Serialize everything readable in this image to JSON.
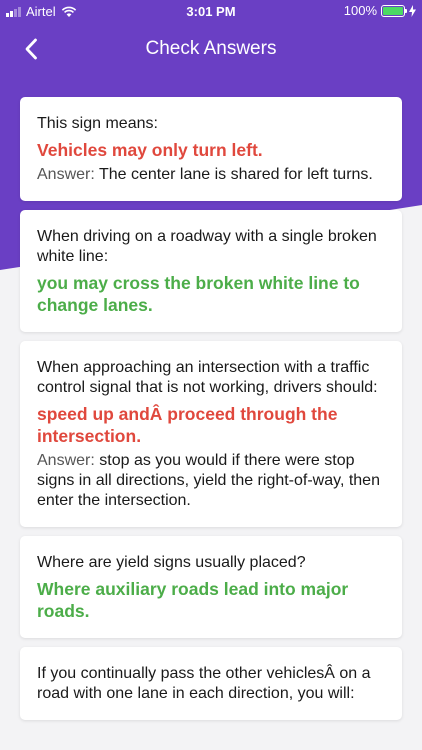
{
  "status": {
    "carrier": "Airtel",
    "time": "3:01 PM",
    "battery": "100%"
  },
  "nav": {
    "title": "Check Answers"
  },
  "colors": {
    "header": "#6a3fc4",
    "wrong": "#e0483d",
    "correct": "#4cad49"
  },
  "answer_label": "Answer:",
  "items": [
    {
      "question": "This sign means:",
      "user_answer": "Vehicles may only turn left.",
      "is_correct": false,
      "correct_answer": "The center lane is shared for left turns."
    },
    {
      "question": "When driving on a roadway with a single broken white line:",
      "user_answer": "you may cross the broken white line to change lanes.",
      "is_correct": true,
      "correct_answer": ""
    },
    {
      "question": "When approaching an intersection with a traffic control signal that is not working, drivers should:",
      "user_answer": "speed up andÂ proceed through the intersection.",
      "is_correct": false,
      "correct_answer": "stop as you would if there were stop signs in all directions, yield the right-of-way, then enter the intersection."
    },
    {
      "question": "Where are yield signs usually placed?",
      "user_answer": "Where auxiliary roads lead into major roads.",
      "is_correct": true,
      "correct_answer": ""
    },
    {
      "question": "If you continually pass the other vehiclesÂ on a road with one lane in each direction, you will:",
      "user_answer": "",
      "is_correct": true,
      "correct_answer": ""
    }
  ]
}
